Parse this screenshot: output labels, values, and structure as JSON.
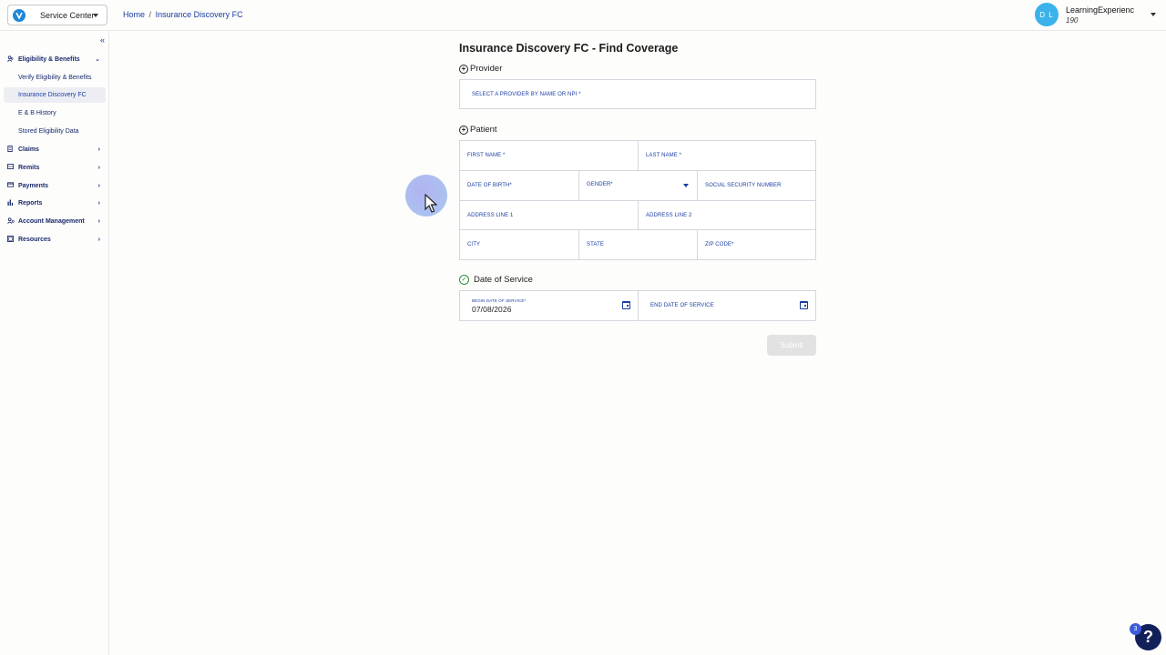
{
  "header": {
    "app_name": "Service Center",
    "breadcrumb_home": "Home",
    "breadcrumb_sep": "/",
    "breadcrumb_current": "Insurance Discovery FC",
    "user_initials": "D L",
    "user_name": "LearningExperienc",
    "user_id": "190"
  },
  "sidebar": {
    "collapse_glyph": "«",
    "items": [
      {
        "label": "Eligibility & Benefits",
        "icon": "users-icon",
        "expanded": true
      },
      {
        "label": "Verify Eligibility & Benefits"
      },
      {
        "label": "Insurance Discovery FC",
        "active": true
      },
      {
        "label": "E & B History"
      },
      {
        "label": "Stored Eligibility Data"
      },
      {
        "label": "Claims",
        "icon": "document-icon"
      },
      {
        "label": "Remits",
        "icon": "list-icon"
      },
      {
        "label": "Payments",
        "icon": "card-icon"
      },
      {
        "label": "Reports",
        "icon": "bar-chart-icon"
      },
      {
        "label": "Account Management",
        "icon": "account-icon"
      },
      {
        "label": "Resources",
        "icon": "book-icon"
      }
    ]
  },
  "form": {
    "title": "Insurance Discovery FC - Find Coverage",
    "provider_section": "Provider",
    "provider_field": "SELECT A PROVIDER BY NAME OR NPI *",
    "patient_section": "Patient",
    "first_name": "FIRST NAME *",
    "last_name": "LAST NAME *",
    "dob": "DATE OF BIRTH*",
    "gender": "GENDER*",
    "ssn": "SOCIAL SECURITY NUMBER",
    "address1": "ADDRESS LINE 1",
    "address2": "ADDRESS LINE 2",
    "city": "CITY",
    "state": "STATE",
    "zip": "ZIP CODE*",
    "dos_section": "Date of Service",
    "begin_label": "BEGIN DATE OF SERVICE*",
    "begin_value": "07/08/2026",
    "end_label": "END DATE OF SERVICE",
    "submit": "Submit"
  },
  "help": {
    "glyph": "?",
    "badge": "3"
  },
  "colors": {
    "accent": "#1a3da0",
    "avatar": "#3bb2ea",
    "help": "#12205a",
    "success": "#2e8b3a"
  }
}
